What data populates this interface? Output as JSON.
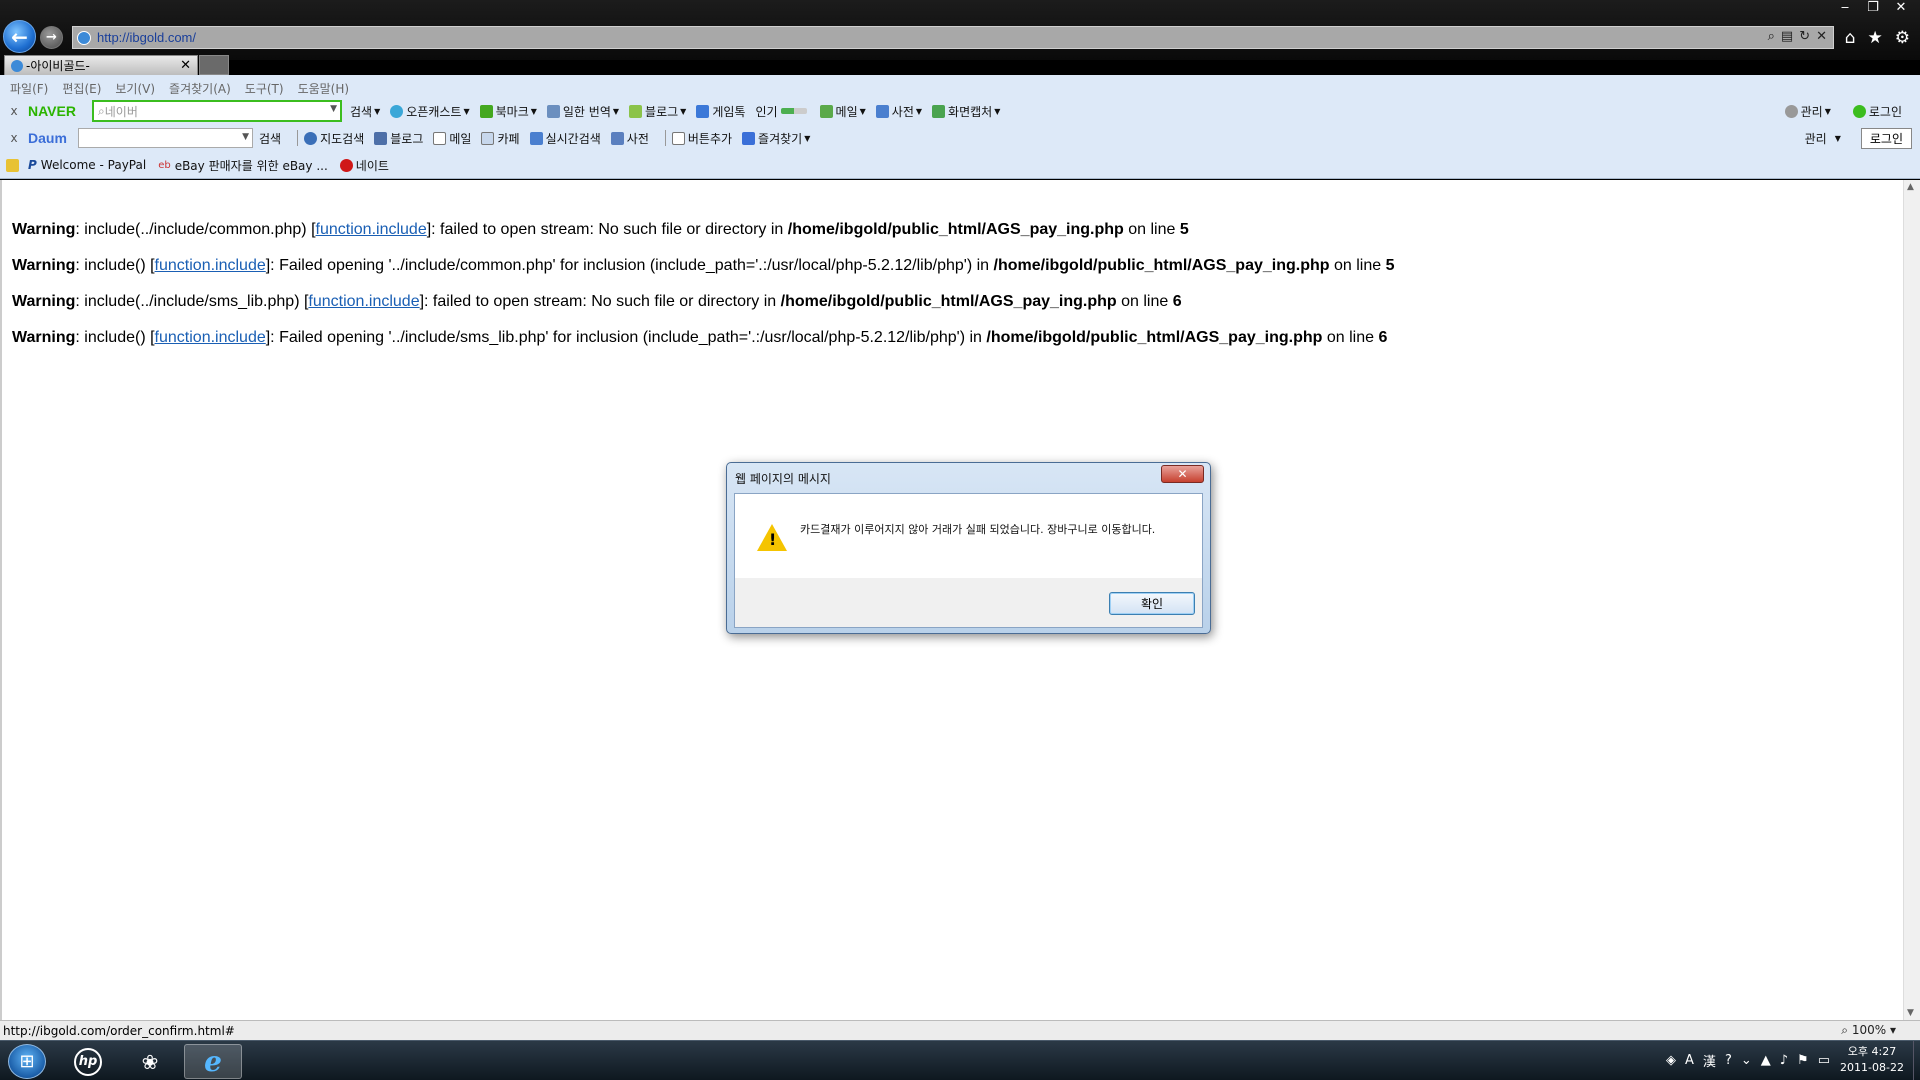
{
  "browser": {
    "url": "http://ibgold.com/",
    "tab_title": "-아이비골드-",
    "tab_close": "✕",
    "window_controls": [
      "‒",
      "❐",
      "✕"
    ],
    "nav_icons": [
      "home-icon",
      "star-icon",
      "gear-icon"
    ]
  },
  "menubar": {
    "items": [
      "파일(F)",
      "편집(E)",
      "보기(V)",
      "즐겨찾기(A)",
      "도구(T)",
      "도움말(H)"
    ]
  },
  "naver_toolbar": {
    "close": "x",
    "logo": "NAVER",
    "search_placeholder": "네이버",
    "items": [
      "검색",
      "오픈캐스트",
      "북마크",
      "일한 번역",
      "블로그",
      "게임톡",
      "인기",
      "메일",
      "사전",
      "화면캡처"
    ],
    "right": [
      "관리",
      "로그인"
    ]
  },
  "daum_toolbar": {
    "close": "x",
    "logo": "Daum",
    "search_button": "검색",
    "items": [
      "지도검색",
      "블로그",
      "메일",
      "카페",
      "실시간검색",
      "사전",
      "버튼추가",
      "즐겨찾기"
    ],
    "right_manage": "관리",
    "right_login": "로그인"
  },
  "favorites_bar": {
    "items": [
      "Welcome - PayPal",
      "eBay 판매자를 위한 eBay ...",
      "네이트"
    ]
  },
  "content": {
    "warnings": [
      {
        "label": "Warning",
        "before": ": include(../include/common.php) [",
        "link": "function.include",
        "after": "]: failed to open stream: No such file or directory in ",
        "path": "/home/ibgold/public_html/AGS_pay_ing.php",
        "line_text": " on line ",
        "line": "5"
      },
      {
        "label": "Warning",
        "before": ": include() [",
        "link": "function.include",
        "after": "]: Failed opening '../include/common.php' for inclusion (include_path='.:/usr/local/php-5.2.12/lib/php') in ",
        "path": "/home/ibgold/public_html/AGS_pay_ing.php",
        "line_text": " on line ",
        "line": "5"
      },
      {
        "label": "Warning",
        "before": ": include(../include/sms_lib.php) [",
        "link": "function.include",
        "after": "]: failed to open stream: No such file or directory in ",
        "path": "/home/ibgold/public_html/AGS_pay_ing.php",
        "line_text": " on line ",
        "line": "6"
      },
      {
        "label": "Warning",
        "before": ": include() [",
        "link": "function.include",
        "after": "]: Failed opening '../include/sms_lib.php' for inclusion (include_path='.:/usr/local/php-5.2.12/lib/php') in ",
        "path": "/home/ibgold/public_html/AGS_pay_ing.php",
        "line_text": " on line ",
        "line": "6"
      }
    ]
  },
  "dialog": {
    "title": "웹 페이지의 메시지",
    "message": "카드결재가 이루어지지 않아 거래가 실패 되었습니다. 장바구니로 이동합니다.",
    "ok_label": "확인",
    "close_symbol": "✕"
  },
  "statusbar": {
    "status_url": "http://ibgold.com/order_confirm.html#",
    "zoom": "100%"
  },
  "taskbar": {
    "clock_period": "오후 4:27",
    "clock_date": "2011-08-22",
    "hp_label": "hp"
  }
}
